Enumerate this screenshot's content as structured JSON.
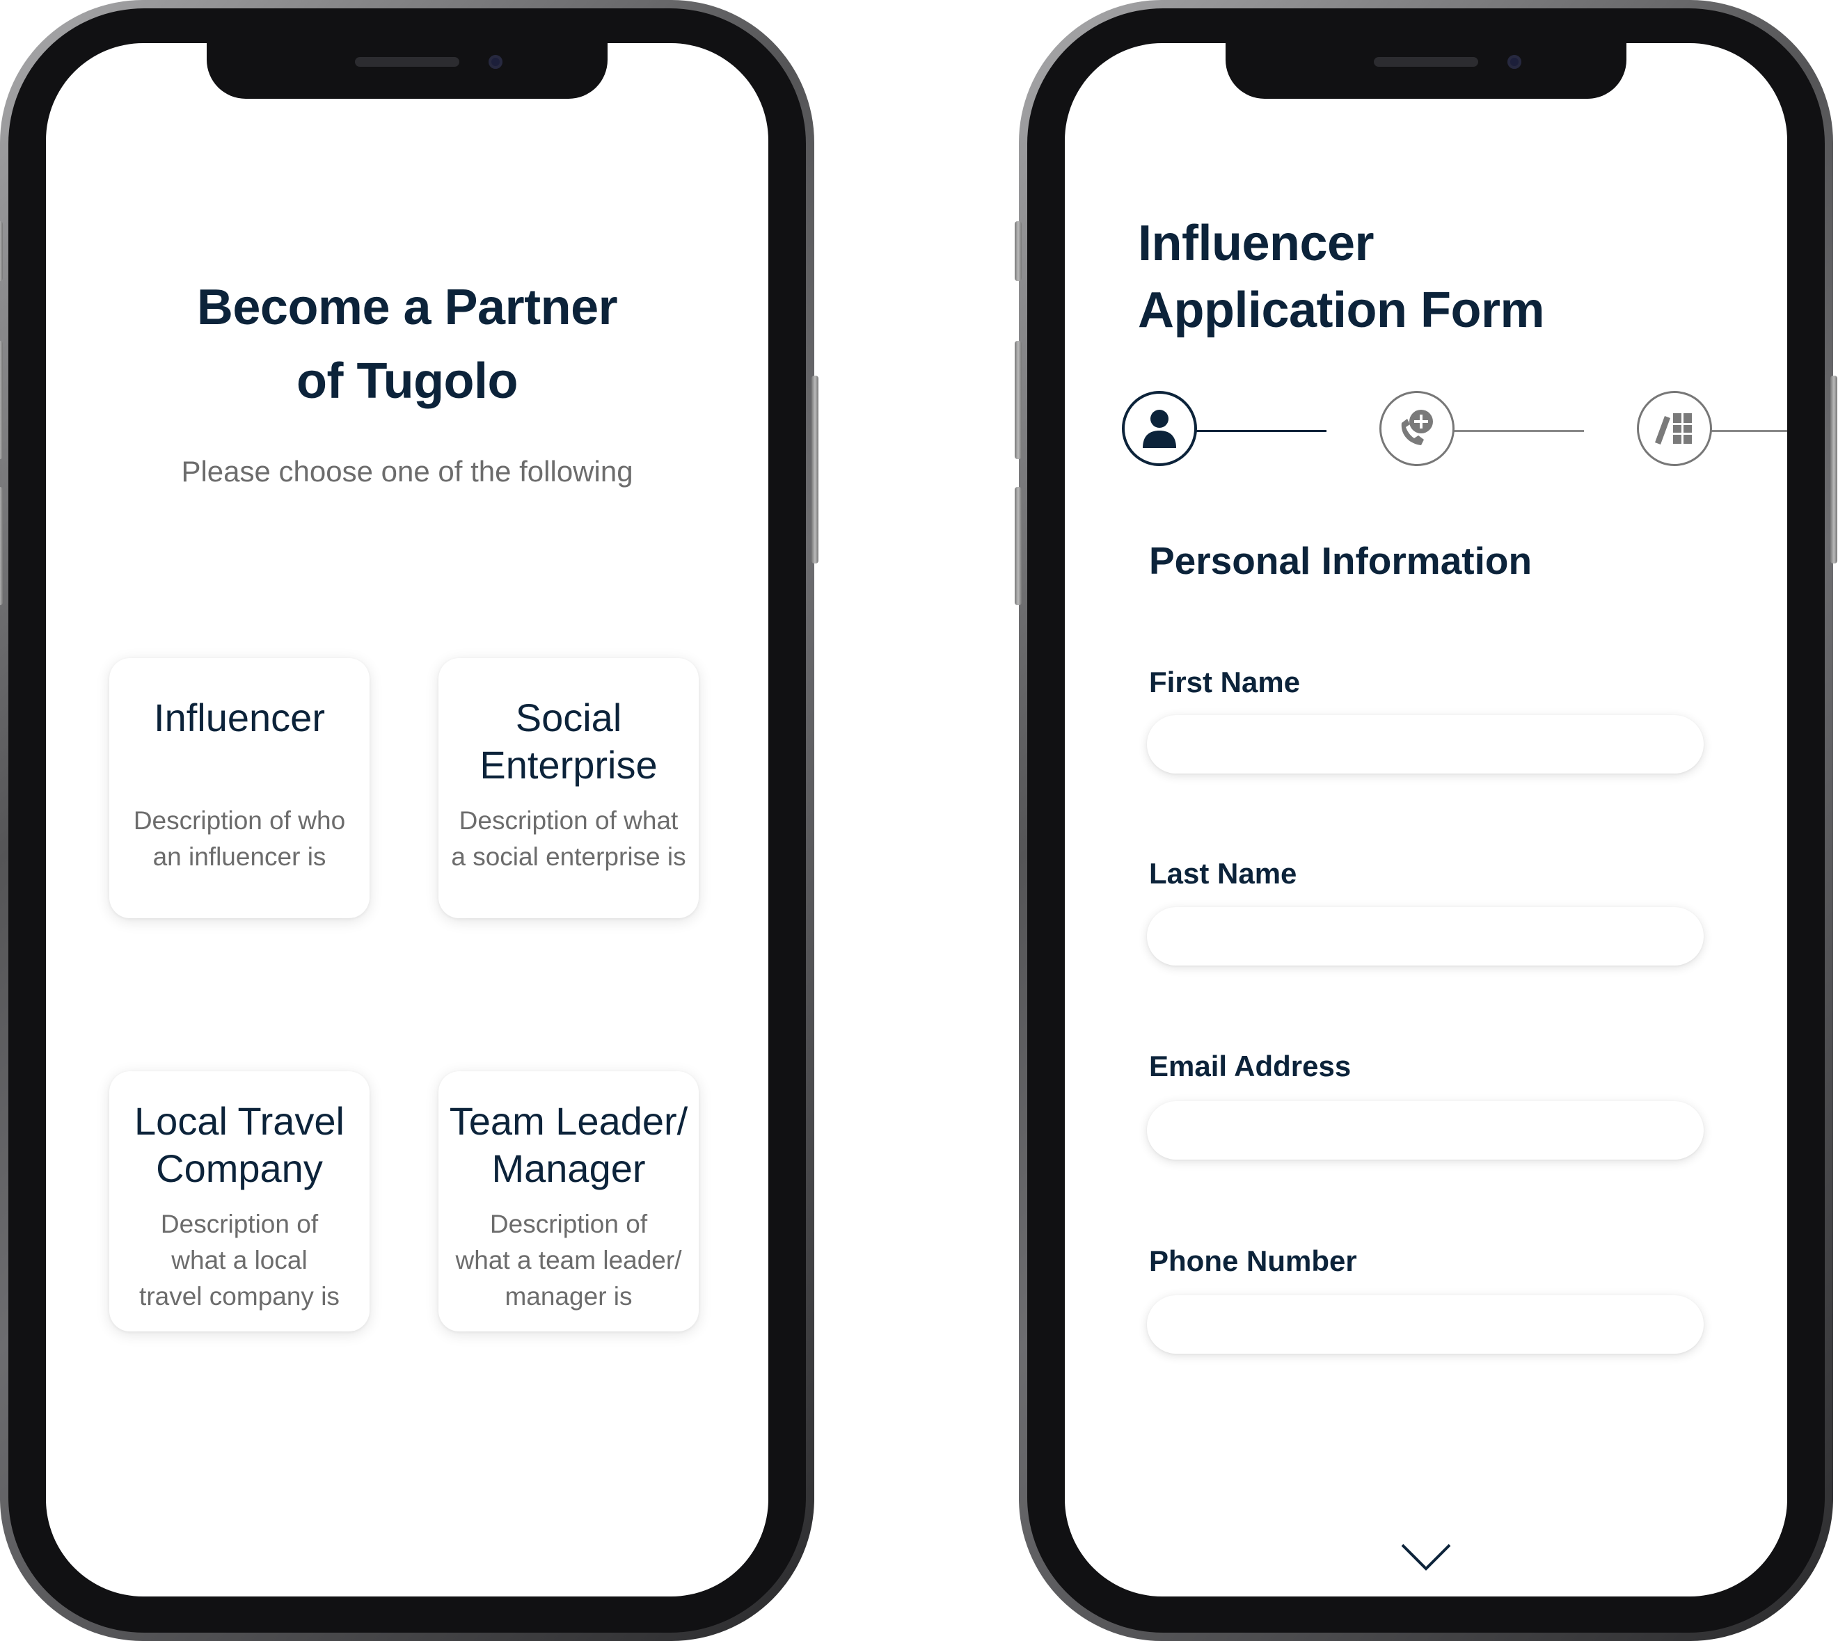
{
  "colors": {
    "primary_text": "#0c233a",
    "secondary_text": "#6c6c6c",
    "step_active": "#0c233a",
    "step_inactive": "#777777",
    "background": "#ffffff"
  },
  "partner_screen": {
    "title": "Become a Partner\nof Tugolo",
    "subtitle": "Please choose one of the following",
    "cards": [
      {
        "title": "Influencer",
        "description": "Description of who\nan influencer is"
      },
      {
        "title": "Social\nEnterprise",
        "description": "Description of what\na social enterprise is"
      },
      {
        "title": "Local Travel\nCompany",
        "description": "Description of\nwhat a local\ntravel company is"
      },
      {
        "title": "Team Leader/\nManager",
        "description": "Description of\nwhat a team leader/\nmanager is"
      }
    ]
  },
  "application_screen": {
    "title": "Influencer\nApplication Form",
    "steps": [
      {
        "icon": "person-icon",
        "state": "active"
      },
      {
        "icon": "phone-add-icon",
        "state": "inactive"
      },
      {
        "icon": "books-icon",
        "state": "inactive"
      }
    ],
    "section_title": "Personal Information",
    "fields": [
      {
        "label": "First Name",
        "value": "",
        "placeholder": ""
      },
      {
        "label": "Last Name",
        "value": "",
        "placeholder": ""
      },
      {
        "label": "Email Address",
        "value": "",
        "placeholder": ""
      },
      {
        "label": "Phone Number",
        "value": "",
        "placeholder": ""
      }
    ],
    "scroll_icon": "chevron-down-icon"
  }
}
